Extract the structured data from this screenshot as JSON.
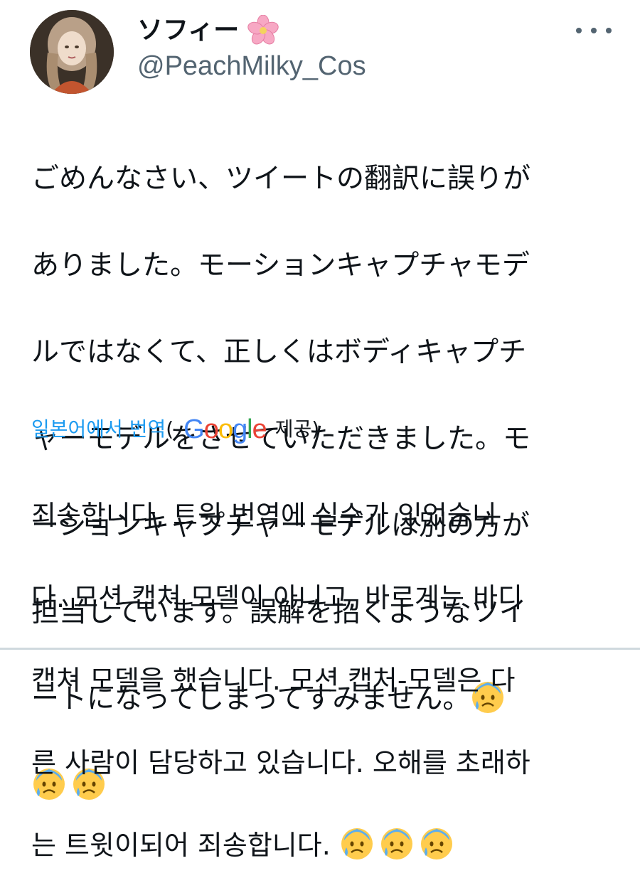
{
  "author": {
    "display_name": "ソフィー",
    "name_emoji": "cherry-blossom-icon",
    "handle": "@PeachMilky_Cos"
  },
  "tweet": {
    "text_lines": [
      "ごめんなさい、ツイートの翻訳に誤りが",
      "ありました。モーションキャプチャモデ",
      "ルではなくて、正しくはボディキャプチ",
      "ャーモデルをさせていただきました。モ",
      "ーションキャプチャーモデルは別の方が",
      "担当しています。誤解を招くようなツイ",
      "ートになってしまってすみません。"
    ],
    "trailing_emojis": [
      "anxious-face-with-sweat-icon",
      "anxious-face-with-sweat-icon",
      "anxious-face-with-sweat-icon"
    ]
  },
  "translation": {
    "link_label": "일본어에서 번역",
    "open_paren": "(",
    "provider": "Google",
    "provided_label": "제공",
    "close_paren": ")",
    "text_lines": [
      "죄송합니다, 트윗 번역에 실수가 있었습니",
      "다. 모션 캡쳐 모델이 아니고, 바르게는 바디",
      "캡쳐 모델을 했습니다. 모션 캡처-모델은 다",
      "른 사람이 담당하고 있습니다. 오해를 초래하",
      "는 트윗이되어 죄송합니다."
    ],
    "trailing_emojis": [
      "anxious-face-with-sweat-icon",
      "anxious-face-with-sweat-icon",
      "anxious-face-with-sweat-icon"
    ]
  },
  "colors": {
    "text": "#0f1419",
    "secondary": "#536471",
    "link": "#1d9bf0"
  }
}
